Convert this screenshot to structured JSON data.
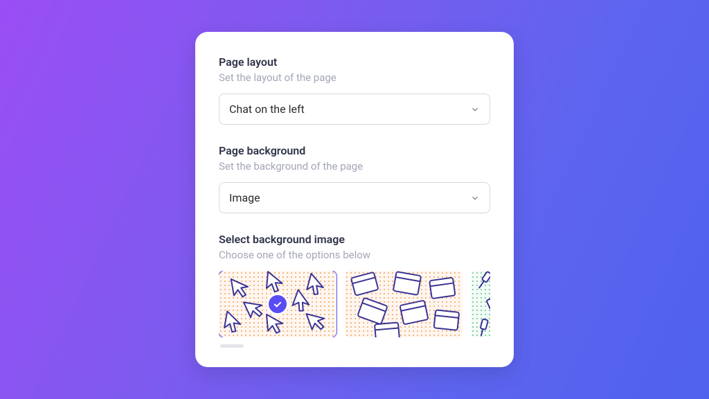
{
  "layout": {
    "title": "Page layout",
    "subtitle": "Set the layout of the page",
    "value": "Chat on the left"
  },
  "background": {
    "title": "Page background",
    "subtitle": "Set the background of the page",
    "value": "Image"
  },
  "bgimage": {
    "title": "Select background image",
    "subtitle": "Choose one of the options below",
    "options": [
      {
        "name": "cursors",
        "selected": true
      },
      {
        "name": "windows",
        "selected": false
      },
      {
        "name": "tools",
        "selected": false
      }
    ]
  },
  "colors": {
    "accent": "#5a4cf3"
  }
}
